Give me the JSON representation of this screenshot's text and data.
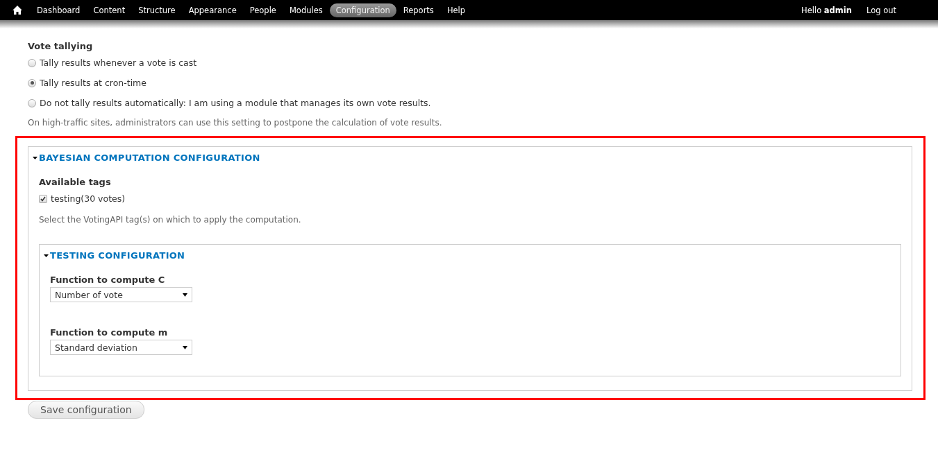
{
  "toolbar": {
    "items": [
      {
        "label": "Dashboard",
        "selected": false
      },
      {
        "label": "Content",
        "selected": false
      },
      {
        "label": "Structure",
        "selected": false
      },
      {
        "label": "Appearance",
        "selected": false
      },
      {
        "label": "People",
        "selected": false
      },
      {
        "label": "Modules",
        "selected": false
      },
      {
        "label": "Configuration",
        "selected": true
      },
      {
        "label": "Reports",
        "selected": false
      },
      {
        "label": "Help",
        "selected": false
      }
    ],
    "greeting": "Hello **admin**",
    "logout": "Log out"
  },
  "vote_tallying": {
    "label": "Vote tallying",
    "options": [
      {
        "label": "Tally results whenever a vote is cast",
        "selected": false
      },
      {
        "label": "Tally results at cron-time",
        "selected": true
      },
      {
        "label": "Do not tally results automatically: I am using a module that manages its own vote results.",
        "selected": false
      }
    ],
    "description": "On high-traffic sites, administrators can use this setting to postpone the calculation of vote results."
  },
  "bayesian": {
    "title": "BAYESIAN COMPUTATION CONFIGURATION",
    "expanded": true,
    "tags_label": "Available tags",
    "tags": [
      {
        "label": "testing(30 votes)",
        "checked": true
      }
    ],
    "description": "Select the VotingAPI tag(s) on which to apply the computation.",
    "testing": {
      "title": "TESTING CONFIGURATION",
      "expanded": true,
      "fields": [
        {
          "label": "Function to compute C",
          "value": "Number of vote"
        },
        {
          "label": "Function to compute m",
          "value": "Standard deviation"
        }
      ]
    }
  },
  "save_button": "Save configuration"
}
